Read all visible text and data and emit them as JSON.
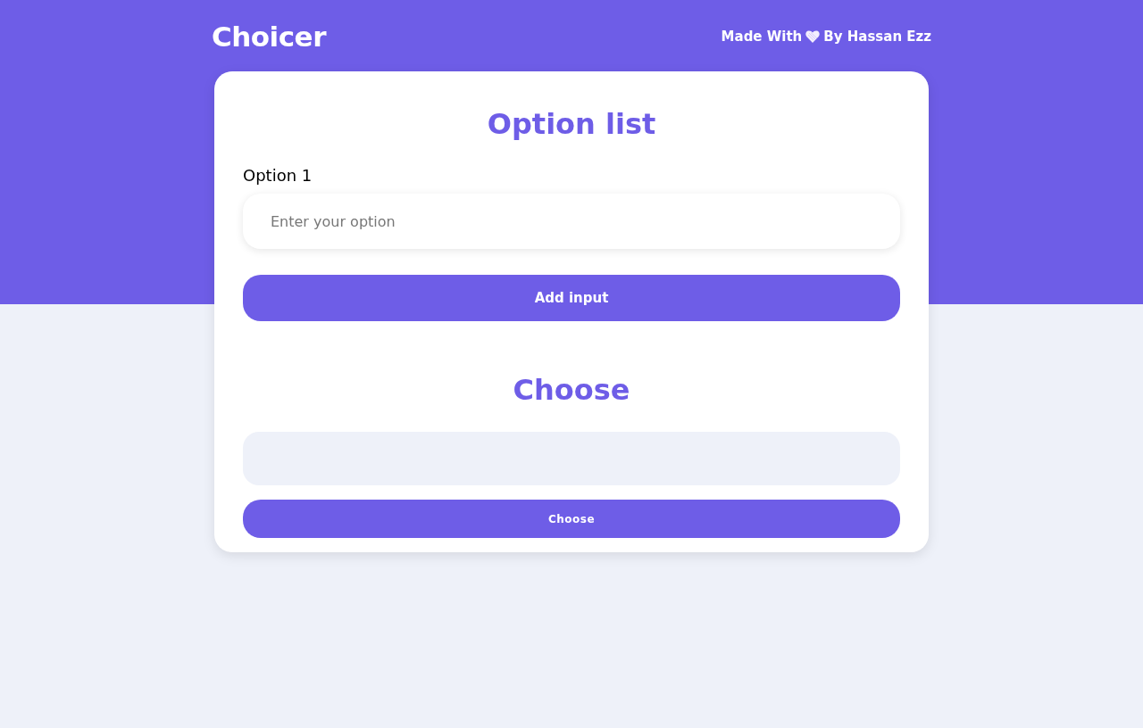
{
  "header": {
    "logo": "Choicer",
    "credit_before": "Made With",
    "credit_after": "By Hassan Ezz"
  },
  "option_list": {
    "title": "Option list",
    "options": [
      {
        "label": "Option 1",
        "placeholder": "Enter your option"
      }
    ],
    "add_button": "Add input"
  },
  "choose": {
    "title": "Choose",
    "button": "Choose"
  }
}
